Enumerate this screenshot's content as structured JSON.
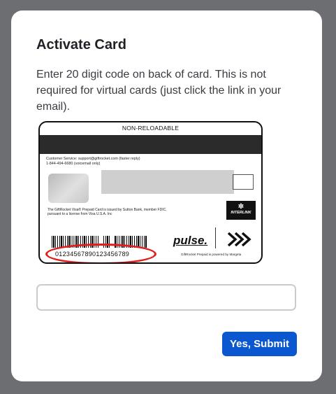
{
  "modal": {
    "title": "Activate Card",
    "description": "Enter 20 digit code on back of card. This is not required for virtual cards (just click the link in your email).",
    "submit_label": "Yes, Submit",
    "code_input": {
      "value": "",
      "placeholder": ""
    }
  },
  "card_image": {
    "header": "NON-RELOADABLE",
    "customer_service_line1": "Customer Service: support@giftrocket.com (faster reply)",
    "customer_service_line2": "1-844-494-6680 (voicemail only)",
    "legal_line1": "The GiftRocket Visa® Prepaid Card is issued by Sutton Bank, member FDIC,",
    "legal_line2": "pursuant to a license from Visa U.S.A. Inc",
    "interlink_label": "INTERLINK",
    "pulse_label": "pulse.",
    "sample_code": "01234567890123456789",
    "powered_by": "GiftRocket Prepaid is powered by Margeta",
    "highlight_color": "#e21b1b"
  },
  "colors": {
    "overlay": "#6c6e72",
    "button": "#0b57d0"
  }
}
